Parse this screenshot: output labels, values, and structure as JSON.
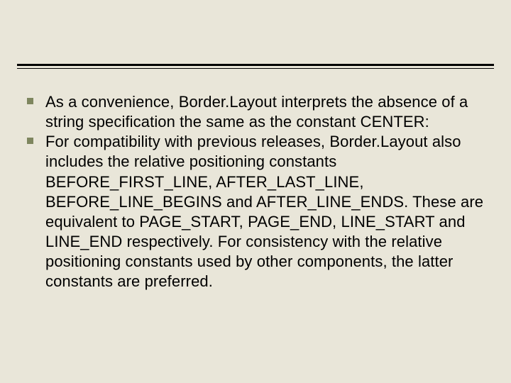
{
  "bullets": [
    {
      "text": "As a convenience, Border.Layout interprets the absence of a string specification the same as the constant CENTER:"
    },
    {
      "text": "For compatibility with previous releases, Border.Layout also includes the relative positioning constants BEFORE_FIRST_LINE, AFTER_LAST_LINE, BEFORE_LINE_BEGINS and AFTER_LINE_ENDS. These are equivalent to PAGE_START, PAGE_END, LINE_START and LINE_END respectively. For consistency with the relative positioning constants used by other components, the latter constants are preferred."
    }
  ],
  "colors": {
    "background": "#e9e6d9",
    "bullet": "#7e865f",
    "rule": "#000000"
  }
}
